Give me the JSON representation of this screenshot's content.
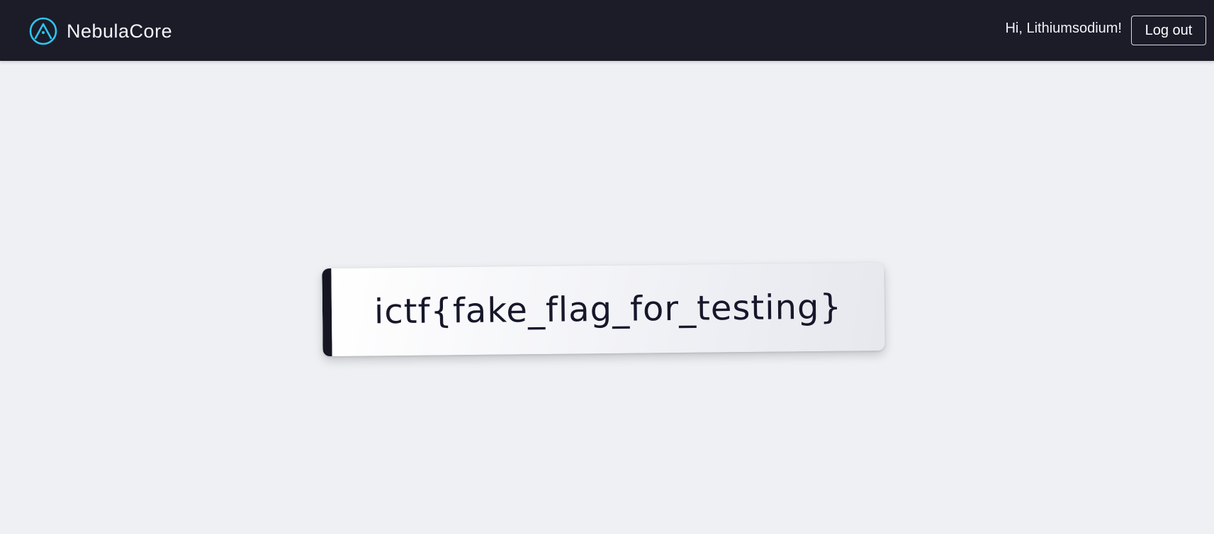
{
  "navbar": {
    "brand_icon": "nebula-peak-icon",
    "brand_name": "NebulaCore",
    "greeting": "Hi, Lithiumsodium!",
    "logout_label": "Log out"
  },
  "main": {
    "flag_text": "ictf{fake_flag_for_testing}"
  },
  "colors": {
    "navbar_bg": "#1b1c28",
    "page_bg": "#eef0f4",
    "brand_accent": "#2ec4f0",
    "card_accent": "#151622"
  }
}
